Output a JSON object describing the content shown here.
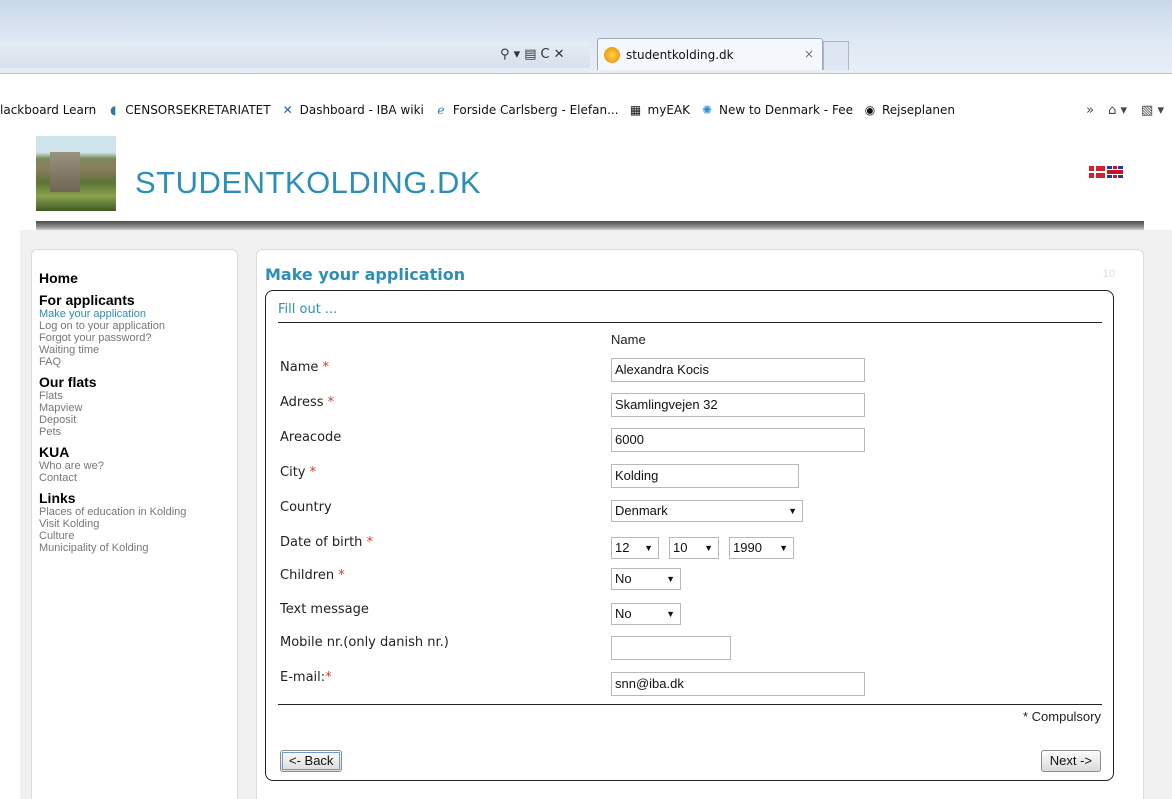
{
  "browser": {
    "tab": {
      "title": "studentkolding.dk",
      "close": "×"
    },
    "nav_icons": [
      "⚲ ▾",
      "▤",
      "C",
      "✕"
    ],
    "favorites": [
      {
        "icon": "bookmark-icon",
        "label": "lackboard Learn"
      },
      {
        "icon": "censor-icon",
        "label": "CENSORSEKRETARIATET"
      },
      {
        "icon": "wiki-icon",
        "label": "Dashboard - IBA wiki"
      },
      {
        "icon": "ie-page-icon",
        "label": "Forside Carlsberg - Elefan..."
      },
      {
        "icon": "building-icon",
        "label": "myEAK"
      },
      {
        "icon": "sun-icon",
        "label": "New to Denmark - Fee"
      },
      {
        "icon": "target-icon",
        "label": "Rejseplanen"
      }
    ],
    "overflow": "»",
    "home_icon": "⌂ ▾",
    "feed_icon": "▧ ▾"
  },
  "site": {
    "title": "STUDENTKOLDING.DK",
    "languages": [
      "Danish",
      "English"
    ]
  },
  "sidebar": {
    "sections": [
      {
        "heading": "Home",
        "links": []
      },
      {
        "heading": "For applicants",
        "links": [
          "Make your application",
          "Log on to your application",
          "Forgot your password?",
          "Waiting time",
          "FAQ"
        ]
      },
      {
        "heading": "Our flats",
        "links": [
          "Flats",
          "Mapview",
          "Deposit",
          "Pets"
        ]
      },
      {
        "heading": "KUA",
        "links": [
          "Who are we?",
          "Contact"
        ]
      },
      {
        "heading": "Links",
        "links": [
          "Places of education in Kolding",
          "Visit Kolding",
          "Culture",
          "Municipality of Kolding"
        ]
      }
    ],
    "active_link": "Make your application"
  },
  "main": {
    "title": "Make your application",
    "page_number": "10",
    "legend": "Fill out ...",
    "name_header": "Name",
    "required_marker": "*",
    "fields": {
      "name": {
        "label": "Name",
        "value": "Alexandra Kocis"
      },
      "address": {
        "label": "Adress",
        "value": "Skamlingvejen 32"
      },
      "areacode": {
        "label": "Areacode",
        "value": "6000"
      },
      "city": {
        "label": "City",
        "value": "Kolding"
      },
      "country": {
        "label": "Country",
        "value": "Denmark"
      },
      "dob": {
        "label": "Date of birth",
        "day": "12",
        "month": "10",
        "year": "1990"
      },
      "children": {
        "label": "Children",
        "value": "No"
      },
      "text_message": {
        "label": "Text message",
        "value": "No"
      },
      "mobile": {
        "label": "Mobile nr.(only danish nr.)",
        "value": ""
      },
      "email": {
        "label": "E-mail:",
        "value": "snn@iba.dk"
      }
    },
    "compulsory_note": "* Compulsory",
    "back_button": "<- Back",
    "next_button": "Next ->"
  }
}
